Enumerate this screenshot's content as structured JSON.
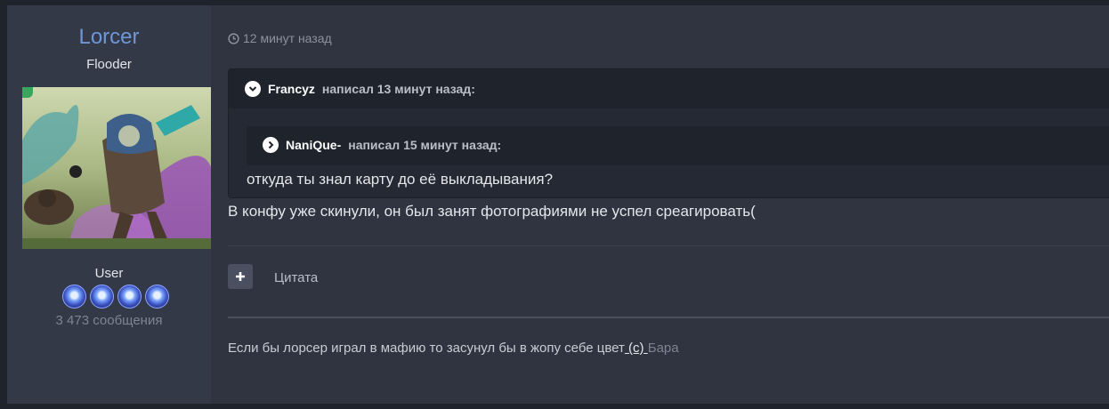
{
  "author": {
    "name": "Lorcer",
    "title": "Flooder",
    "group": "User",
    "posts_count": "3 473 сообщения",
    "badge_count": 4
  },
  "post": {
    "time": "12 минут назад",
    "quote_outer": {
      "user": "Francyz",
      "cite_text": "написал 13 минут назад:",
      "body": "откуда ты знал карту до её выкладывания?"
    },
    "quote_inner": {
      "user": "NaniQue-",
      "cite_text": "написал 15 минут назад:"
    },
    "text": "В конфу уже скинули, он был занят фотографиями не успел среагировать(",
    "quote_button_label": "Цитата"
  },
  "signature": {
    "text": "Если бы лорсер играл в мафию то засунул бы в жопу себе цвет",
    "link": " (с) ",
    "tail": "Бара"
  },
  "colors": {
    "author_name": "#6f97d8",
    "background": "#2f3440",
    "online": "#3aa55d"
  }
}
